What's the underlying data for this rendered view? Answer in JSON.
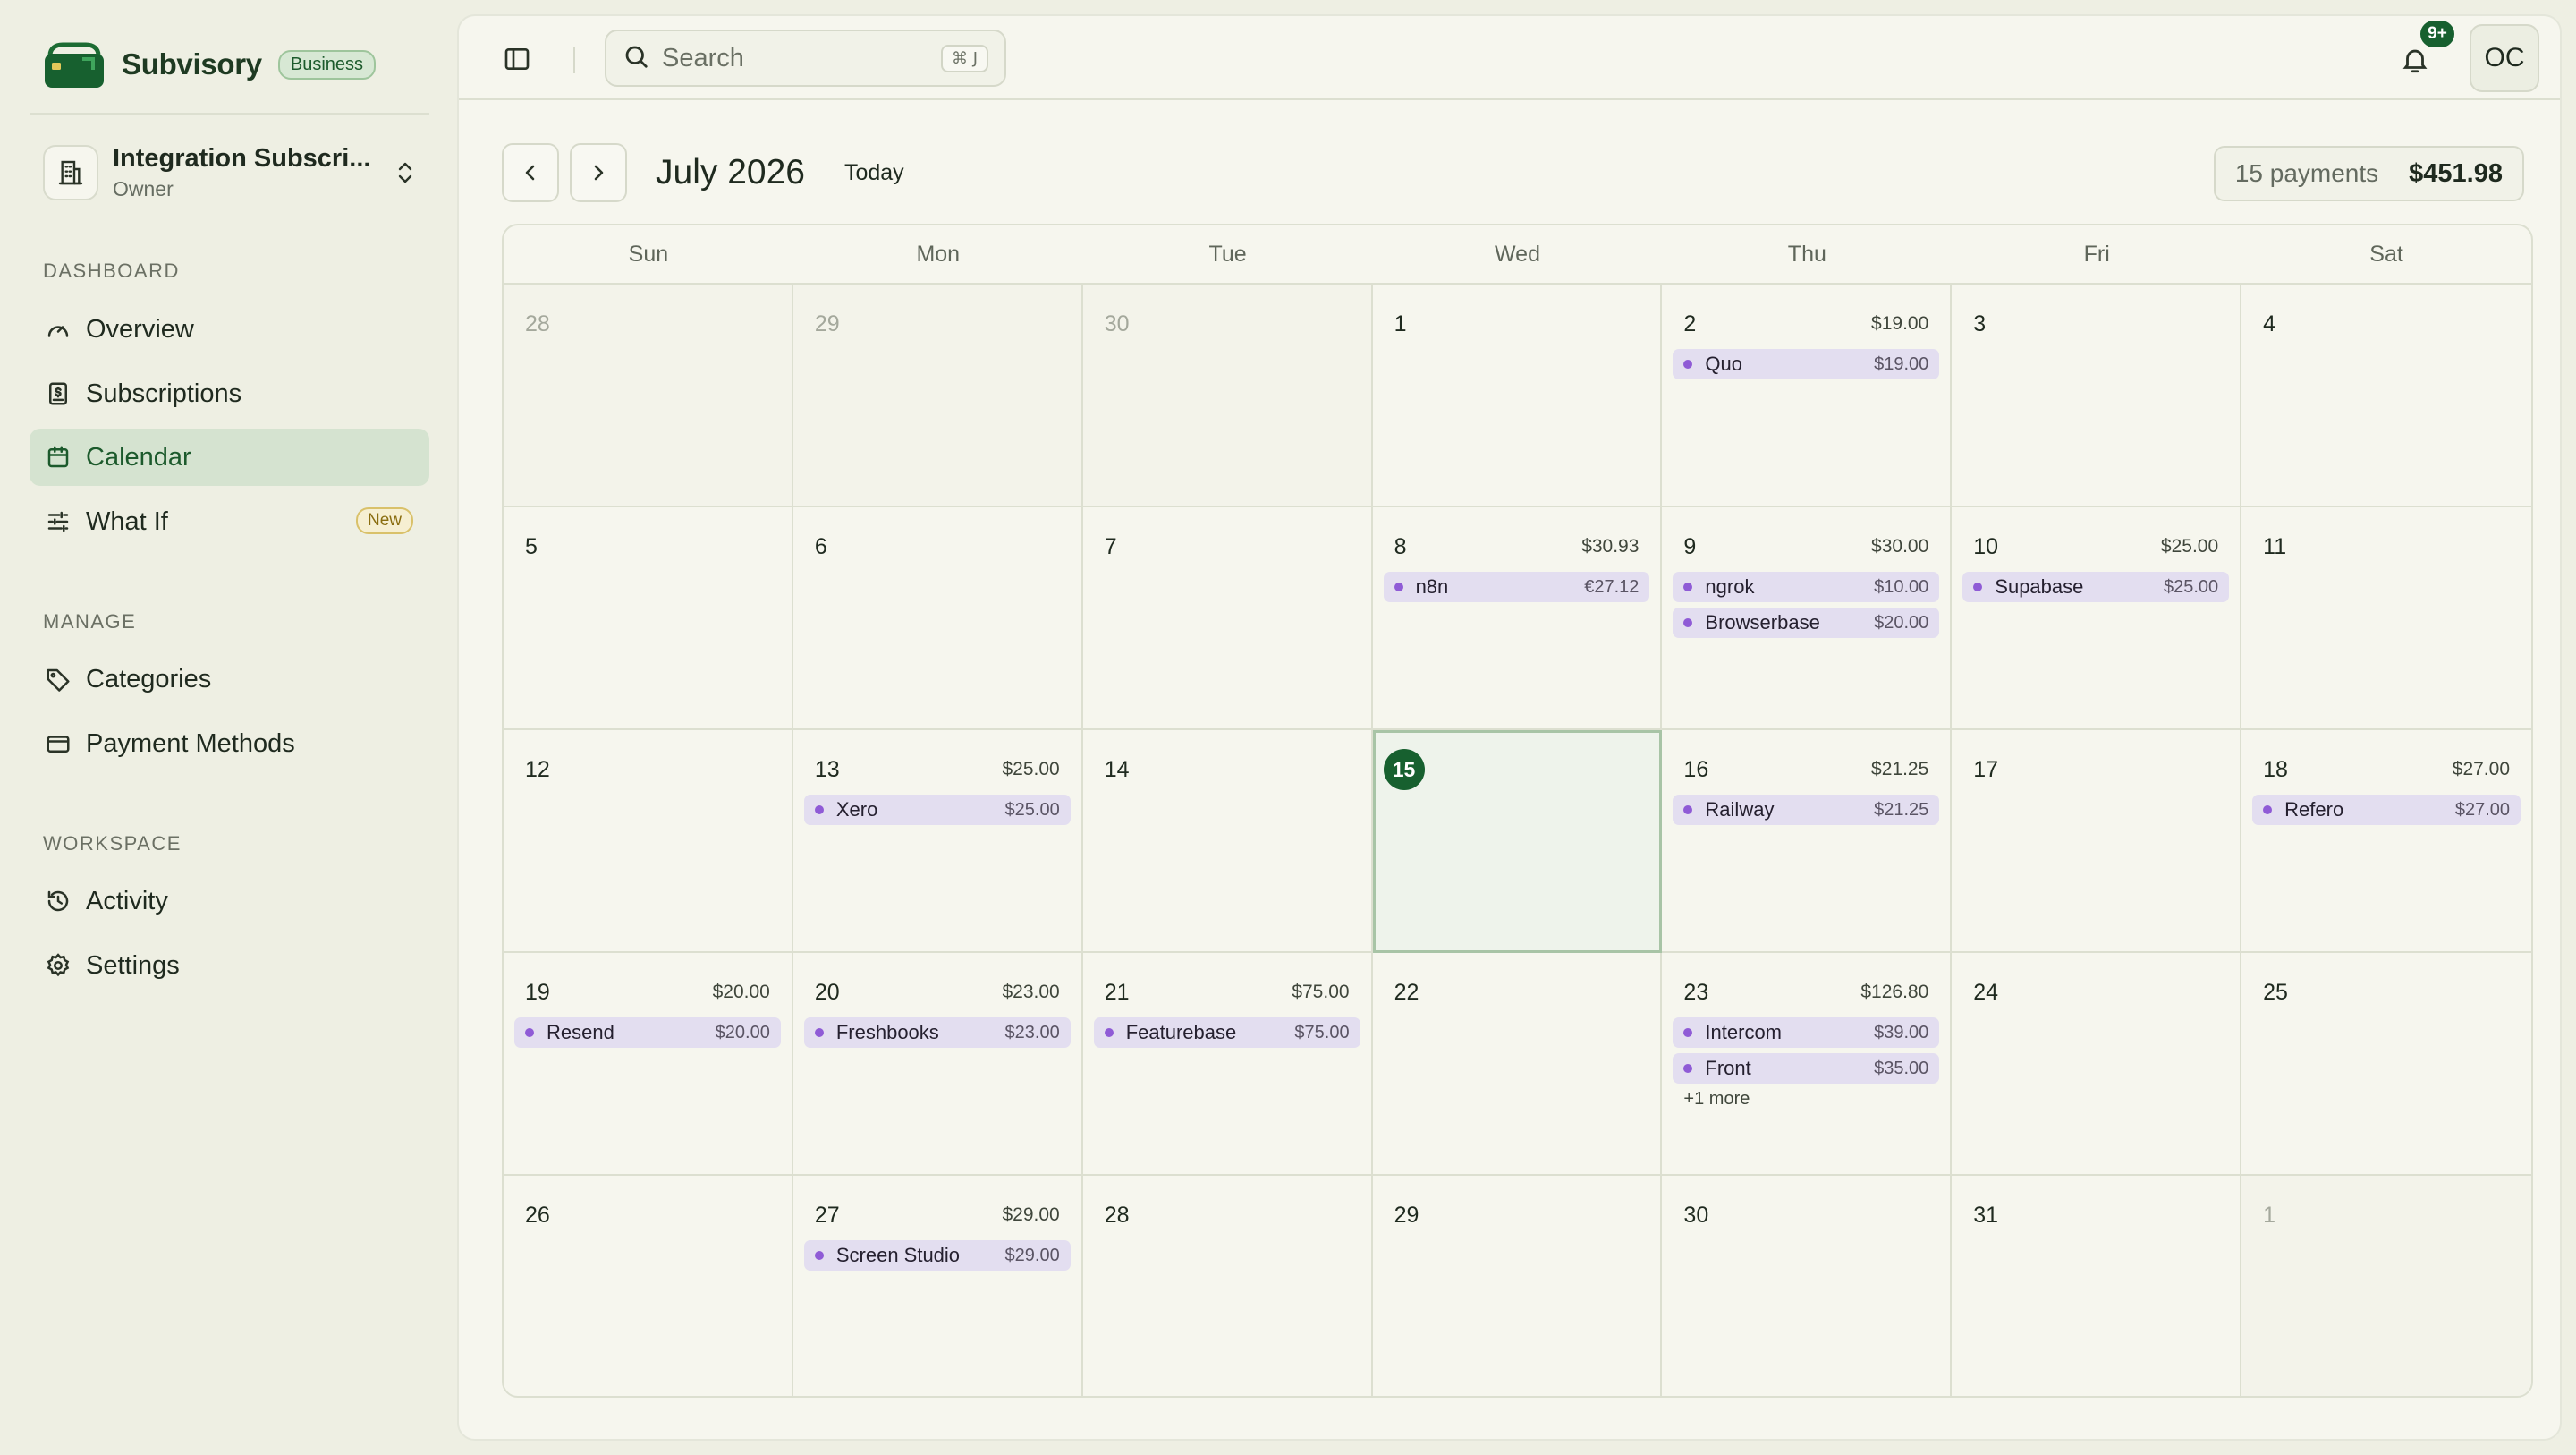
{
  "brand": {
    "name": "Subvisory",
    "badge": "Business"
  },
  "org": {
    "name": "Integration Subscri...",
    "role": "Owner"
  },
  "sidebar": {
    "sections": [
      {
        "label": "DASHBOARD",
        "items": [
          {
            "label": "Overview",
            "icon": "gauge-icon"
          },
          {
            "label": "Subscriptions",
            "icon": "receipt-icon"
          },
          {
            "label": "Calendar",
            "icon": "calendar-icon",
            "active": true
          },
          {
            "label": "What If",
            "icon": "sliders-icon",
            "badge": "New"
          }
        ]
      },
      {
        "label": "MANAGE",
        "items": [
          {
            "label": "Categories",
            "icon": "tag-icon"
          },
          {
            "label": "Payment Methods",
            "icon": "credit-card-icon"
          }
        ]
      },
      {
        "label": "WORKSPACE",
        "items": [
          {
            "label": "Activity",
            "icon": "history-icon"
          },
          {
            "label": "Settings",
            "icon": "gear-icon"
          }
        ]
      }
    ]
  },
  "topbar": {
    "search_placeholder": "Search",
    "search_shortcut": "⌘ J",
    "notifications_badge": "9+",
    "avatar_initials": "OC"
  },
  "calendar": {
    "month_title": "July 2026",
    "today_label": "Today",
    "summary_count": "15 payments",
    "summary_total": "$451.98",
    "weekdays": [
      "Sun",
      "Mon",
      "Tue",
      "Wed",
      "Thu",
      "Fri",
      "Sat"
    ],
    "days": [
      {
        "day": "28",
        "outside": true
      },
      {
        "day": "29",
        "outside": true
      },
      {
        "day": "30",
        "outside": true
      },
      {
        "day": "1"
      },
      {
        "day": "2",
        "total": "$19.00",
        "events": [
          {
            "name": "Quo",
            "amount": "$19.00"
          }
        ]
      },
      {
        "day": "3"
      },
      {
        "day": "4"
      },
      {
        "day": "5"
      },
      {
        "day": "6"
      },
      {
        "day": "7"
      },
      {
        "day": "8",
        "total": "$30.93",
        "events": [
          {
            "name": "n8n",
            "amount": "€27.12"
          }
        ]
      },
      {
        "day": "9",
        "total": "$30.00",
        "events": [
          {
            "name": "ngrok",
            "amount": "$10.00"
          },
          {
            "name": "Browserbase",
            "amount": "$20.00"
          }
        ]
      },
      {
        "day": "10",
        "total": "$25.00",
        "events": [
          {
            "name": "Supabase",
            "amount": "$25.00"
          }
        ]
      },
      {
        "day": "11"
      },
      {
        "day": "12"
      },
      {
        "day": "13",
        "total": "$25.00",
        "events": [
          {
            "name": "Xero",
            "amount": "$25.00"
          }
        ]
      },
      {
        "day": "14"
      },
      {
        "day": "15",
        "today": true
      },
      {
        "day": "16",
        "total": "$21.25",
        "events": [
          {
            "name": "Railway",
            "amount": "$21.25"
          }
        ]
      },
      {
        "day": "17"
      },
      {
        "day": "18",
        "total": "$27.00",
        "events": [
          {
            "name": "Refero",
            "amount": "$27.00"
          }
        ]
      },
      {
        "day": "19",
        "total": "$20.00",
        "events": [
          {
            "name": "Resend",
            "amount": "$20.00"
          }
        ]
      },
      {
        "day": "20",
        "total": "$23.00",
        "events": [
          {
            "name": "Freshbooks",
            "amount": "$23.00"
          }
        ]
      },
      {
        "day": "21",
        "total": "$75.00",
        "events": [
          {
            "name": "Featurebase",
            "amount": "$75.00"
          }
        ]
      },
      {
        "day": "22"
      },
      {
        "day": "23",
        "total": "$126.80",
        "events": [
          {
            "name": "Intercom",
            "amount": "$39.00"
          },
          {
            "name": "Front",
            "amount": "$35.00"
          }
        ],
        "more": "+1 more"
      },
      {
        "day": "24"
      },
      {
        "day": "25"
      },
      {
        "day": "26"
      },
      {
        "day": "27",
        "total": "$29.00",
        "events": [
          {
            "name": "Screen Studio",
            "amount": "$29.00"
          }
        ]
      },
      {
        "day": "28"
      },
      {
        "day": "29"
      },
      {
        "day": "30"
      },
      {
        "day": "31"
      },
      {
        "day": "1",
        "outside": true
      }
    ]
  },
  "colors": {
    "brand": "#17602f",
    "event_dot": "#8f5bd6",
    "event_bg": "#e3def0"
  }
}
